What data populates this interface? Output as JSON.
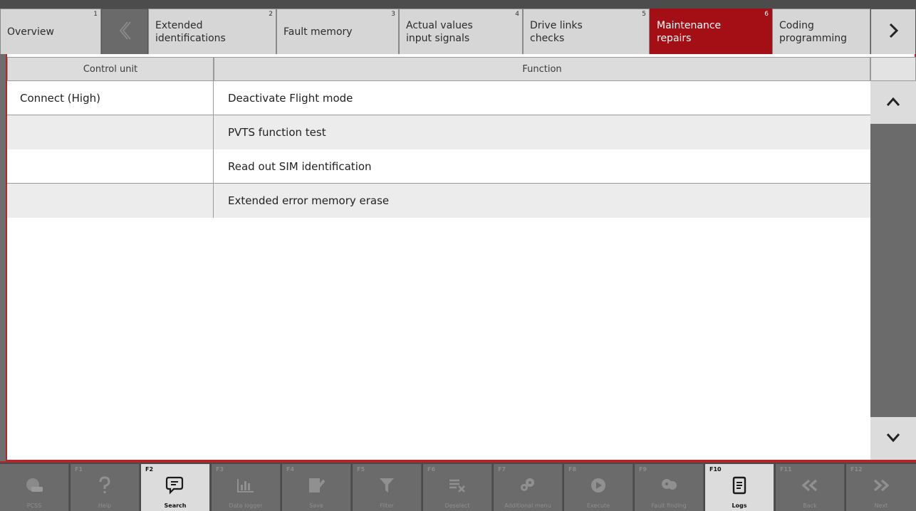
{
  "tabs": [
    {
      "label": "Overview",
      "num": "1"
    },
    {
      "label": "Extended\nidentifications",
      "num": "2"
    },
    {
      "label": "Fault memory",
      "num": "3"
    },
    {
      "label": "Actual values\ninput signals",
      "num": "4"
    },
    {
      "label": "Drive links\nchecks",
      "num": "5"
    },
    {
      "label": "Maintenance\nrepairs",
      "num": "6"
    },
    {
      "label": "Coding\nprogramming",
      "num": ""
    }
  ],
  "table": {
    "headers": {
      "control_unit": "Control unit",
      "function": "Function"
    },
    "rows": [
      {
        "control_unit": "Connect (High)",
        "function": "Deactivate Flight mode"
      },
      {
        "control_unit": "",
        "function": "PVTS function test"
      },
      {
        "control_unit": "",
        "function": "Read out SIM identification"
      },
      {
        "control_unit": "",
        "function": "Extended error memory erase"
      }
    ]
  },
  "toolbar": [
    {
      "key": "",
      "label": "PCSS",
      "icon": "car-icon"
    },
    {
      "key": "F1",
      "label": "Help",
      "icon": "help-icon"
    },
    {
      "key": "F2",
      "label": "Search",
      "icon": "search-icon"
    },
    {
      "key": "F3",
      "label": "Data logger",
      "icon": "data-logger-icon"
    },
    {
      "key": "F4",
      "label": "Save",
      "icon": "save-icon"
    },
    {
      "key": "F5",
      "label": "Filter",
      "icon": "filter-icon"
    },
    {
      "key": "F6",
      "label": "Deselect",
      "icon": "deselect-icon"
    },
    {
      "key": "F7",
      "label": "Additional menu",
      "icon": "additional-menu-icon"
    },
    {
      "key": "F8",
      "label": "Execute",
      "icon": "execute-icon"
    },
    {
      "key": "F9",
      "label": "Fault finding",
      "icon": "fault-finding-icon"
    },
    {
      "key": "F10",
      "label": "Logs",
      "icon": "logs-icon"
    },
    {
      "key": "F11",
      "label": "Back",
      "icon": "back-icon"
    },
    {
      "key": "F12",
      "label": "Next",
      "icon": "next-icon"
    }
  ],
  "colors": {
    "active_tab": "#a30f14",
    "accent_border": "#b0262a"
  }
}
